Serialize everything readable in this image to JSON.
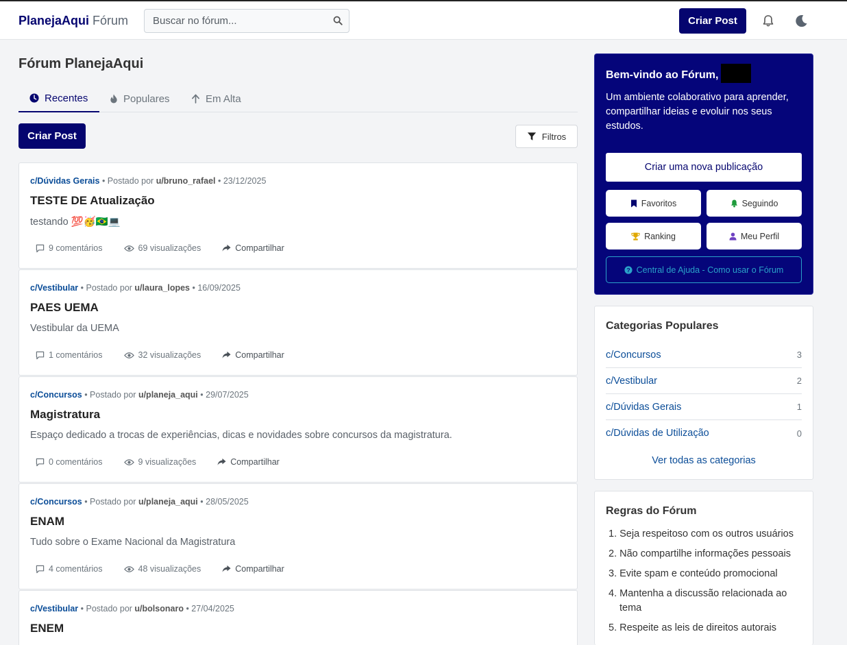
{
  "nav": {
    "brand_main": "PlanejaAqui",
    "brand_sub": "Fórum",
    "search_placeholder": "Buscar no fórum...",
    "create_post": "Criar Post"
  },
  "main": {
    "title": "Fórum PlanejaAqui",
    "tabs": [
      {
        "label": "Recentes",
        "active": true
      },
      {
        "label": "Populares",
        "active": false
      },
      {
        "label": "Em Alta",
        "active": false
      }
    ],
    "create_post": "Criar Post",
    "filters": "Filtros"
  },
  "posts": [
    {
      "category": "c/Dúvidas Gerais",
      "posted_by": "• Postado por",
      "user": "u/bruno_rafael",
      "date": "• 23/12/2025",
      "title": "TESTE DE Atualização",
      "body": "testando 💯🥳🇧🇷💻",
      "comments": "9 comentários",
      "views": "69 visualizações",
      "share": "Compartilhar"
    },
    {
      "category": "c/Vestibular",
      "posted_by": "• Postado por",
      "user": "u/laura_lopes",
      "date": "• 16/09/2025",
      "title": "PAES UEMA",
      "body": "Vestibular da UEMA",
      "comments": "1 comentários",
      "views": "32 visualizações",
      "share": "Compartilhar"
    },
    {
      "category": "c/Concursos",
      "posted_by": "• Postado por",
      "user": "u/planeja_aqui",
      "date": "• 29/07/2025",
      "title": "Magistratura",
      "body": "Espaço dedicado a trocas de experiências, dicas e novidades sobre concursos da magistratura.",
      "comments": "0 comentários",
      "views": "9 visualizações",
      "share": "Compartilhar"
    },
    {
      "category": "c/Concursos",
      "posted_by": "• Postado por",
      "user": "u/planeja_aqui",
      "date": "• 28/05/2025",
      "title": "ENAM",
      "body": "Tudo sobre o Exame Nacional da Magistratura",
      "comments": "4 comentários",
      "views": "48 visualizações",
      "share": "Compartilhar"
    },
    {
      "category": "c/Vestibular",
      "posted_by": "• Postado por",
      "user": "u/bolsonaro",
      "date": "• 27/04/2025",
      "title": "ENEM",
      "body": "",
      "comments": "",
      "views": "",
      "share": ""
    }
  ],
  "welcome": {
    "title": "Bem-vindo ao Fórum,",
    "text": "Um ambiente colaborativo para aprender, compartilhar ideias e evoluir nos seus estudos.",
    "new_post": "Criar uma nova publicação",
    "favorites": "Favoritos",
    "following": "Seguindo",
    "ranking": "Ranking",
    "profile": "Meu Perfil",
    "help": "Central de Ajuda - Como usar o Fórum"
  },
  "categories": {
    "title": "Categorias Populares",
    "items": [
      {
        "name": "c/Concursos",
        "count": "3"
      },
      {
        "name": "c/Vestibular",
        "count": "2"
      },
      {
        "name": "c/Dúvidas Gerais",
        "count": "1"
      },
      {
        "name": "c/Dúvidas de Utilização",
        "count": "0"
      }
    ],
    "see_all": "Ver todas as categorias"
  },
  "rules": {
    "title": "Regras do Fórum",
    "items": [
      "1. Seja respeitoso com os outros usuários",
      "2. Não compartilhe informações pessoais",
      "3. Evite spam e conteúdo promocional",
      "4. Mantenha a discussão relacionada ao tema",
      "5. Respeite as leis de direitos autorais"
    ]
  },
  "colors": {
    "primary": "#05056f",
    "link": "#0b4d98",
    "help": "#2aa2c9",
    "background": "#f3f4f6"
  }
}
